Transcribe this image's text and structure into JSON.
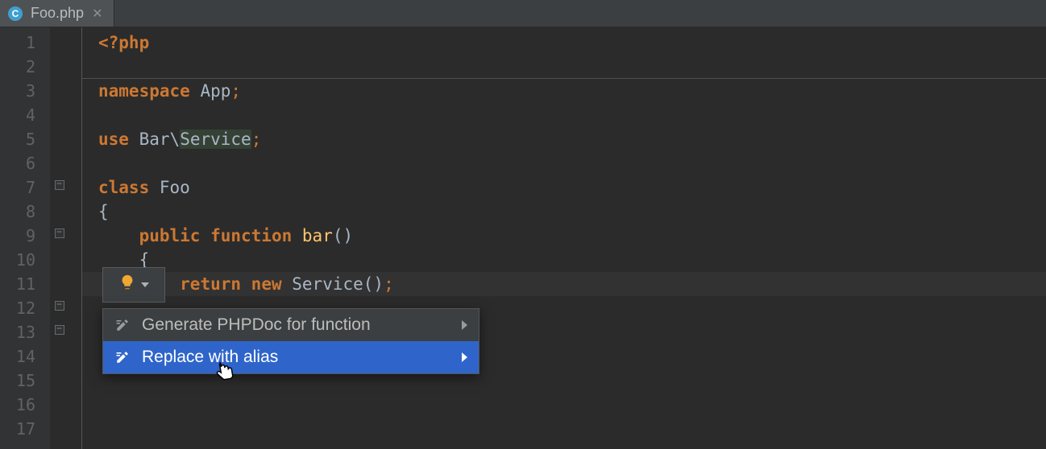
{
  "tab": {
    "filename": "Foo.php",
    "icon_letter": "C"
  },
  "gutter": {
    "start": 1,
    "end": 17
  },
  "code": {
    "l1": "<?php",
    "l3_kw": "namespace",
    "l3_nm": "App",
    "l5_kw": "use",
    "l5_a": "Bar",
    "l5_b": "Service",
    "l7_kw": "class",
    "l7_nm": "Foo",
    "l8": "{",
    "l9_a": "public",
    "l9_b": "function",
    "l9_fn": "bar",
    "l10": "    {",
    "l11_a": "return",
    "l11_b": "new",
    "l11_c": "Service",
    "punct_semi": ";",
    "punct_back": "\\",
    "punct_paren": "()"
  },
  "intention": {
    "items": [
      {
        "label": "Generate PHPDoc for function",
        "selected": false
      },
      {
        "label": "Replace with alias",
        "selected": true
      }
    ]
  }
}
